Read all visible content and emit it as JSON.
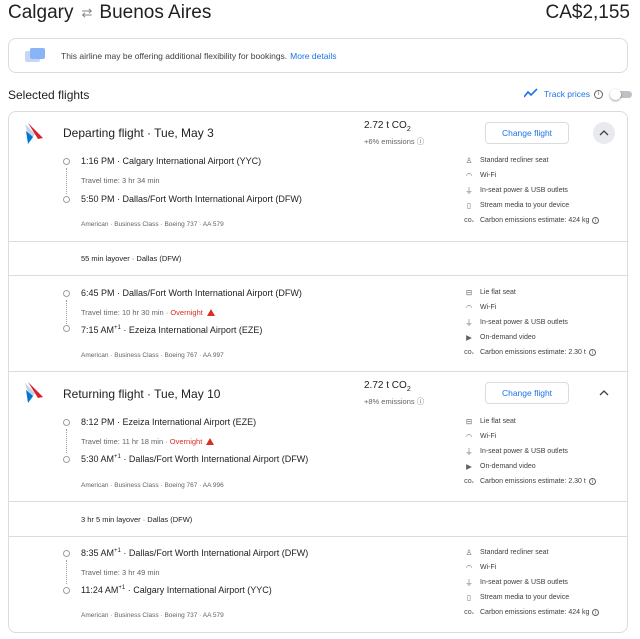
{
  "header": {
    "origin": "Calgary",
    "swap_icon": "⇄",
    "destination": "Buenos Aires",
    "price": "CA$2,155"
  },
  "notice": {
    "text": "This airline may be offering additional flexibility for bookings.",
    "link": "More details"
  },
  "selected": {
    "title": "Selected flights",
    "track_label": "Track prices",
    "track_enabled": false
  },
  "colors": {
    "accent": "#1a73e8",
    "warning": "#d93025",
    "border": "#dadce0"
  },
  "departing": {
    "title": "Departing flight · Tue, May 3",
    "co2": "2.72 t CO",
    "co2_sub": "2",
    "emissions": "+6% emissions",
    "button": "Change flight",
    "leg1": {
      "dep_time": "1:16 PM",
      "dep_sup": "",
      "dep_airport": "Calgary International Airport (YYC)",
      "travel": "Travel time: 3 hr 34 min",
      "overnight": "",
      "arr_time": "5:50 PM",
      "arr_sup": "",
      "arr_airport": "Dallas/Fort Worth International Airport (DFW)",
      "meta": "American · Business Class · Boeing 737 · AA 579",
      "amenities": [
        "Standard recliner seat",
        "Wi-Fi",
        "In-seat power & USB outlets",
        "Stream media to your device"
      ],
      "carbon": "Carbon emissions estimate: 424 kg"
    },
    "layover": "55 min layover · Dallas (DFW)",
    "leg2": {
      "dep_time": "6:45 PM",
      "dep_sup": "",
      "dep_airport": "Dallas/Fort Worth International Airport (DFW)",
      "travel": "Travel time: 10 hr 30 min",
      "overnight": "Overnight",
      "arr_time": "7:15 AM",
      "arr_sup": "+1",
      "arr_airport": "Ezeiza International Airport (EZE)",
      "meta": "American · Business Class · Boeing 767 · AA 997",
      "amenities": [
        "Lie flat seat",
        "Wi-Fi",
        "In-seat power & USB outlets",
        "On-demand video"
      ],
      "carbon": "Carbon emissions estimate: 2.30 t"
    }
  },
  "returning": {
    "title": "Returning flight · Tue, May 10",
    "co2": "2.72 t CO",
    "co2_sub": "2",
    "emissions": "+8% emissions",
    "button": "Change flight",
    "leg1": {
      "dep_time": "8:12 PM",
      "dep_sup": "",
      "dep_airport": "Ezeiza International Airport (EZE)",
      "travel": "Travel time: 11 hr 18 min",
      "overnight": "Overnight",
      "arr_time": "5:30 AM",
      "arr_sup": "+1",
      "arr_airport": "Dallas/Fort Worth International Airport (DFW)",
      "meta": "American · Business Class · Boeing 767 · AA 996",
      "amenities": [
        "Lie flat seat",
        "Wi-Fi",
        "In-seat power & USB outlets",
        "On-demand video"
      ],
      "carbon": "Carbon emissions estimate: 2.30 t"
    },
    "layover": "3 hr 5 min layover · Dallas (DFW)",
    "leg2": {
      "dep_time": "8:35 AM",
      "dep_sup": "+1",
      "dep_airport": "Dallas/Fort Worth International Airport (DFW)",
      "travel": "Travel time: 3 hr 49 min",
      "overnight": "",
      "arr_time": "11:24 AM",
      "arr_sup": "+1",
      "arr_airport": "Calgary International Airport (YYC)",
      "meta": "American · Business Class · Boeing 737 · AA 579",
      "amenities": [
        "Standard recliner seat",
        "Wi-Fi",
        "In-seat power & USB outlets",
        "Stream media to your device"
      ],
      "carbon": "Carbon emissions estimate: 424 kg"
    }
  }
}
